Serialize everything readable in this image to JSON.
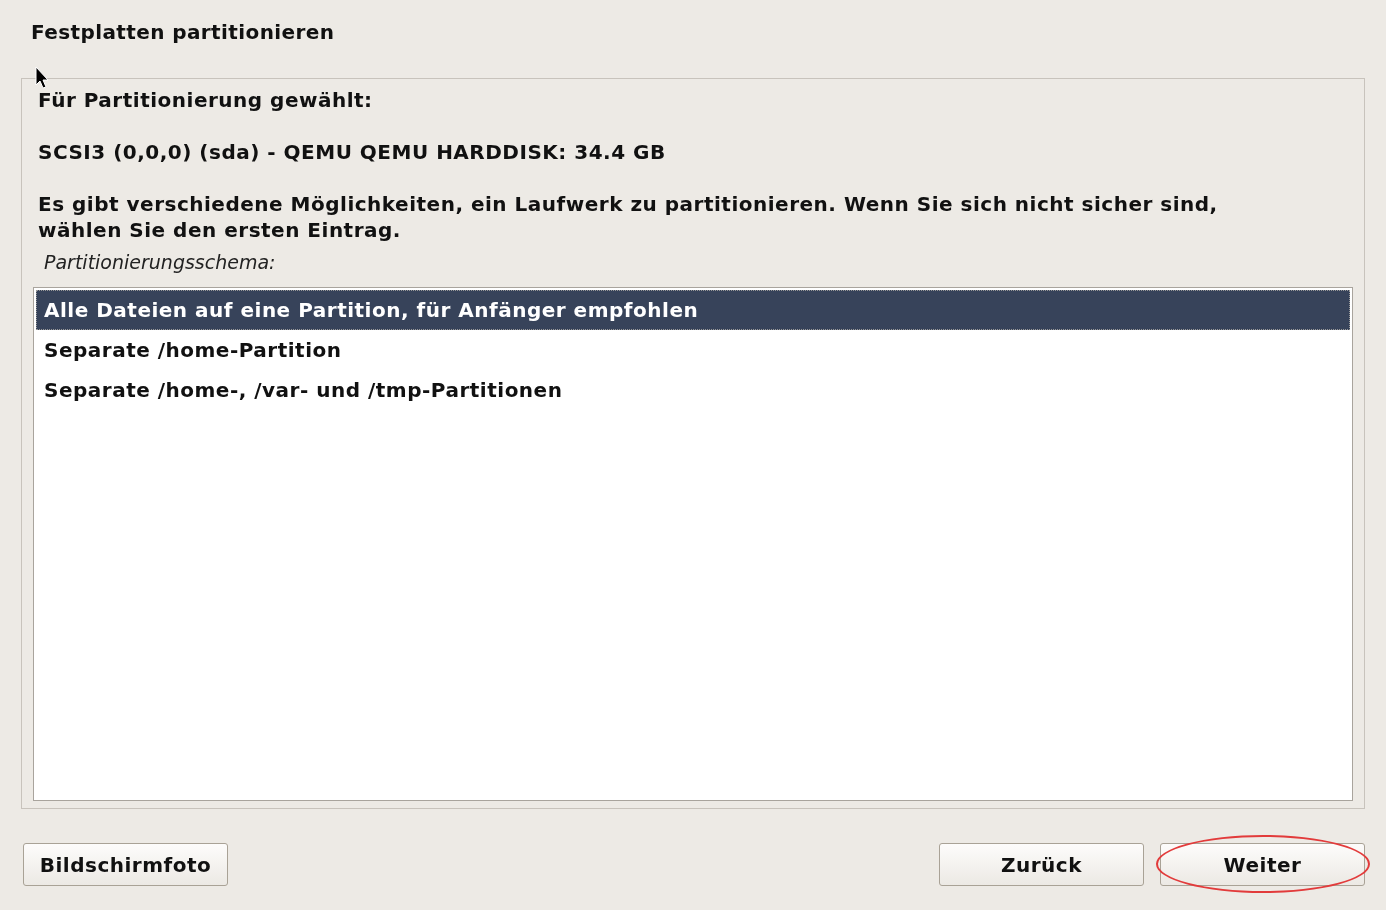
{
  "window": {
    "title": "Festplatten partitionieren"
  },
  "heading": "Für Partitionierung gewählt:",
  "disk": "SCSI3 (0,0,0) (sda) - QEMU QEMU HARDDISK: 34.4 GB",
  "description": "Es gibt verschiedene Möglichkeiten, ein Laufwerk zu partitionieren. Wenn Sie sich nicht sicher sind, wählen Sie den ersten Eintrag.",
  "list_label": "Partitionierungsschema:",
  "options": [
    {
      "label": "Alle Dateien auf eine Partition, für Anfänger empfohlen",
      "selected": true
    },
    {
      "label": "Separate /home-Partition",
      "selected": false
    },
    {
      "label": "Separate /home-, /var- und /tmp-Partitionen",
      "selected": false
    }
  ],
  "left_buttons": [
    {
      "label": "Bildschirmfoto",
      "circled": false
    }
  ],
  "right_buttons": [
    {
      "label": "Zurück",
      "circled": false
    },
    {
      "label": "Weiter",
      "circled": true
    }
  ]
}
